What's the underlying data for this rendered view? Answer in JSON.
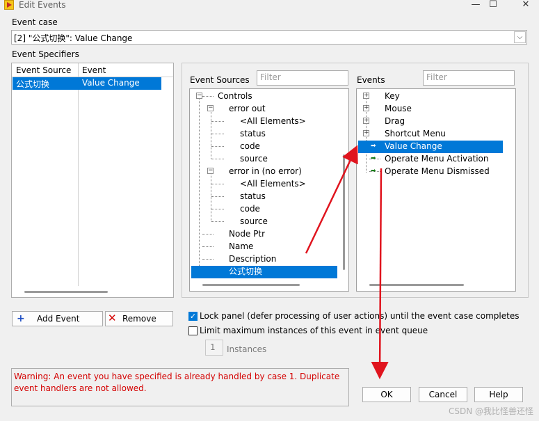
{
  "window": {
    "title": "Edit Events",
    "controls": {
      "minimize": "—",
      "maximize": "☐",
      "close": "✕"
    }
  },
  "event_case": {
    "label": "Event case",
    "value": "[2] \"公式切换\": Value Change",
    "dropdown_icon": "chevron-down-icon"
  },
  "specifiers": {
    "label": "Event Specifiers",
    "columns": [
      "Event Source",
      "Event"
    ],
    "rows": [
      {
        "source": "公式切换",
        "event": "Value Change"
      }
    ]
  },
  "event_sources": {
    "label": "Event Sources",
    "filter_placeholder": "Filter",
    "tree": [
      {
        "label": "Controls"
      },
      {
        "label": "error out"
      },
      {
        "label": "<All Elements>"
      },
      {
        "label": "status"
      },
      {
        "label": "code"
      },
      {
        "label": "source"
      },
      {
        "label": "error in (no error)"
      },
      {
        "label": "<All Elements>"
      },
      {
        "label": "status"
      },
      {
        "label": "code"
      },
      {
        "label": "source"
      },
      {
        "label": "Node Ptr"
      },
      {
        "label": "Name"
      },
      {
        "label": "Description"
      },
      {
        "label": "公式切换"
      }
    ]
  },
  "events": {
    "label": "Events",
    "filter_placeholder": "Filter",
    "tree": [
      {
        "label": "Key"
      },
      {
        "label": "Mouse"
      },
      {
        "label": "Drag"
      },
      {
        "label": "Shortcut Menu"
      },
      {
        "label": "Value Change"
      },
      {
        "label": "Operate Menu Activation"
      },
      {
        "label": "Operate Menu Dismissed"
      }
    ]
  },
  "buttons": {
    "add_event": "Add Event",
    "remove": "Remove",
    "ok": "OK",
    "cancel": "Cancel",
    "help": "Help"
  },
  "options": {
    "lock_panel": "Lock panel (defer processing of user actions) until the event case completes",
    "lock_panel_checked": true,
    "limit_instances": "Limit maximum instances of this event in event queue",
    "limit_instances_checked": false,
    "instances_value": "1",
    "instances_label": "Instances"
  },
  "warning": "Warning:  An event you have specified is already handled by case 1. Duplicate event handlers are not allowed.",
  "watermark": "CSDN @我比怪兽还怪",
  "colors": {
    "selection": "#0078d7",
    "warning_text": "#d40000",
    "annotation_arrow": "#e0141e"
  }
}
